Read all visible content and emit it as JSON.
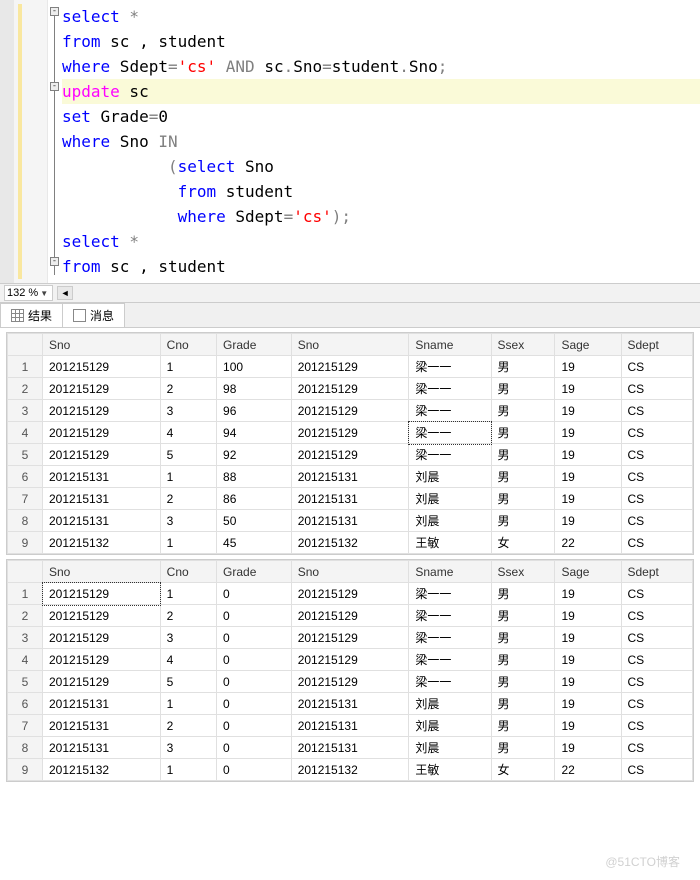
{
  "code": {
    "l1": {
      "kw": "select",
      "rest": " *"
    },
    "l2": {
      "kw": "from",
      "rest": " sc , student"
    },
    "l3": {
      "kw": "where",
      "id1": " Sdept",
      "op1": "=",
      "str": "'cs'",
      "and": " AND ",
      "id2": "sc",
      "dot1": ".",
      "id3": "Sno",
      "op2": "=",
      "id4": "student",
      "dot2": ".",
      "id5": "Sno",
      "semi": ";"
    },
    "l4": {
      "kw": "update",
      "rest": " sc"
    },
    "l5": {
      "kw": "set",
      "id": " Grade",
      "op": "=",
      "num": "0"
    },
    "l6": {
      "kw": "where",
      "id": " Sno ",
      "in": "IN"
    },
    "l7": {
      "indent": "           (",
      "kw": "select",
      "id": " Sno"
    },
    "l8": {
      "indent": "            ",
      "kw": "from",
      "id": " student"
    },
    "l9": {
      "indent": "            ",
      "kw": "where",
      "id": " Sdept",
      "op": "=",
      "str": "'cs'",
      "close": ");"
    },
    "l10": {
      "kw": "select",
      "rest": " *"
    },
    "l11": {
      "kw": "from",
      "rest": " sc , student"
    }
  },
  "zoom": "132 %",
  "tabs": {
    "results": "结果",
    "messages": "消息"
  },
  "headers": [
    "Sno",
    "Cno",
    "Grade",
    "Sno",
    "Sname",
    "Ssex",
    "Sage",
    "Sdept"
  ],
  "table1": [
    [
      "1",
      "201215129",
      "1",
      "100",
      "201215129",
      "梁一一",
      "男",
      "19",
      "CS"
    ],
    [
      "2",
      "201215129",
      "2",
      "98",
      "201215129",
      "梁一一",
      "男",
      "19",
      "CS"
    ],
    [
      "3",
      "201215129",
      "3",
      "96",
      "201215129",
      "梁一一",
      "男",
      "19",
      "CS"
    ],
    [
      "4",
      "201215129",
      "4",
      "94",
      "201215129",
      "梁一一",
      "男",
      "19",
      "CS"
    ],
    [
      "5",
      "201215129",
      "5",
      "92",
      "201215129",
      "梁一一",
      "男",
      "19",
      "CS"
    ],
    [
      "6",
      "201215131",
      "1",
      "88",
      "201215131",
      "刘晨",
      "男",
      "19",
      "CS"
    ],
    [
      "7",
      "201215131",
      "2",
      "86",
      "201215131",
      "刘晨",
      "男",
      "19",
      "CS"
    ],
    [
      "8",
      "201215131",
      "3",
      "50",
      "201215131",
      "刘晨",
      "男",
      "19",
      "CS"
    ],
    [
      "9",
      "201215132",
      "1",
      "45",
      "201215132",
      "王敏",
      "女",
      "22",
      "CS"
    ]
  ],
  "table2": [
    [
      "1",
      "201215129",
      "1",
      "0",
      "201215129",
      "梁一一",
      "男",
      "19",
      "CS"
    ],
    [
      "2",
      "201215129",
      "2",
      "0",
      "201215129",
      "梁一一",
      "男",
      "19",
      "CS"
    ],
    [
      "3",
      "201215129",
      "3",
      "0",
      "201215129",
      "梁一一",
      "男",
      "19",
      "CS"
    ],
    [
      "4",
      "201215129",
      "4",
      "0",
      "201215129",
      "梁一一",
      "男",
      "19",
      "CS"
    ],
    [
      "5",
      "201215129",
      "5",
      "0",
      "201215129",
      "梁一一",
      "男",
      "19",
      "CS"
    ],
    [
      "6",
      "201215131",
      "1",
      "0",
      "201215131",
      "刘晨",
      "男",
      "19",
      "CS"
    ],
    [
      "7",
      "201215131",
      "2",
      "0",
      "201215131",
      "刘晨",
      "男",
      "19",
      "CS"
    ],
    [
      "8",
      "201215131",
      "3",
      "0",
      "201215131",
      "刘晨",
      "男",
      "19",
      "CS"
    ],
    [
      "9",
      "201215132",
      "1",
      "0",
      "201215132",
      "王敏",
      "女",
      "22",
      "CS"
    ]
  ],
  "selected": {
    "t1_row": 3,
    "t1_col": 5,
    "t2_row": 0,
    "t2_col": 1
  },
  "watermark": "@51CTO博客"
}
